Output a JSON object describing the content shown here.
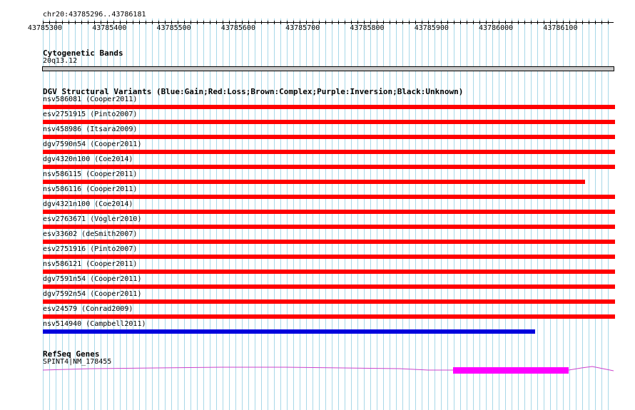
{
  "ruler": {
    "region": "chr20:43785296..43786181",
    "ticks": [
      "43785300",
      "43785400",
      "43785500",
      "43785600",
      "43785700",
      "43785800",
      "43785900",
      "43786000",
      "43786100"
    ]
  },
  "cyto": {
    "title": "Cytogenetic Bands",
    "band": "20q13.12"
  },
  "dgv": {
    "title": "DGV Structural Variants (Blue:Gain;Red:Loss;Brown:Complex;Purple:Inversion;Black:Unknown)",
    "colors": {
      "loss": "#ff0000",
      "gain": "#0000dd"
    },
    "variants": [
      {
        "label": "nsv586081 (Cooper2011)",
        "type": "loss",
        "end_fraction": 1.0
      },
      {
        "label": "esv2751915 (Pinto2007)",
        "type": "loss",
        "end_fraction": 1.0
      },
      {
        "label": "nsv458986 (Itsara2009)",
        "type": "loss",
        "end_fraction": 1.0
      },
      {
        "label": "dgv7590n54 (Cooper2011)",
        "type": "loss",
        "end_fraction": 1.0
      },
      {
        "label": "dgv4320n100 (Coe2014)",
        "type": "loss",
        "end_fraction": 1.0
      },
      {
        "label": "nsv586115 (Cooper2011)",
        "type": "loss",
        "end_fraction": 0.947
      },
      {
        "label": "nsv586116 (Cooper2011)",
        "type": "loss",
        "end_fraction": 1.0
      },
      {
        "label": "dgv4321n100 (Coe2014)",
        "type": "loss",
        "end_fraction": 1.0
      },
      {
        "label": "esv2763671 (Vogler2010)",
        "type": "loss",
        "end_fraction": 1.0
      },
      {
        "label": "esv33602 (deSmith2007)",
        "type": "loss",
        "end_fraction": 1.0
      },
      {
        "label": "esv2751916 (Pinto2007)",
        "type": "loss",
        "end_fraction": 1.0
      },
      {
        "label": "nsv586121 (Cooper2011)",
        "type": "loss",
        "end_fraction": 1.0
      },
      {
        "label": "dgv7591n54 (Cooper2011)",
        "type": "loss",
        "end_fraction": 1.0
      },
      {
        "label": "dgv7592n54 (Cooper2011)",
        "type": "loss",
        "end_fraction": 1.0
      },
      {
        "label": "esv24579 (Conrad2009)",
        "type": "loss",
        "end_fraction": 1.0
      },
      {
        "label": "nsv514940 (Campbell2011)",
        "type": "gain",
        "end_fraction": 0.86
      }
    ]
  },
  "refseq": {
    "title": "RefSeq Genes",
    "gene_label": "SPINT4|NM_178455",
    "colors": {
      "intron": "#cc44cc",
      "exon": "#ff00ff"
    }
  },
  "colors": {
    "grid": "#a8d8e8",
    "band": "#c8c8c8"
  }
}
